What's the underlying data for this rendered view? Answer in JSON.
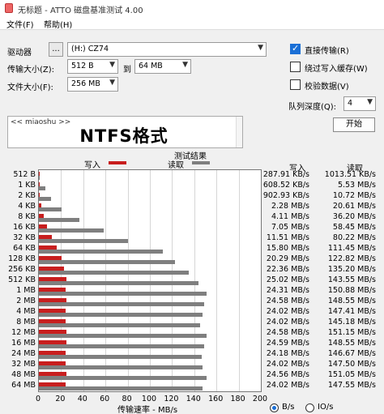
{
  "window": {
    "title": "无标题 - ATTO 磁盘基准测试 4.00"
  },
  "menu": {
    "file": "文件(F)",
    "help": "帮助(H)"
  },
  "drive": {
    "label": "驱动器",
    "browse": "...",
    "value": "(H:) CZ74"
  },
  "transfer": {
    "label": "传输大小(Z):",
    "from": "512 B",
    "to_label": "到",
    "to": "64 MB"
  },
  "filesize": {
    "label": "文件大小(F):",
    "value": "256 MB"
  },
  "options": {
    "direct_io": {
      "label": "直接传输(R)",
      "checked": true
    },
    "bypass_cache": {
      "label": "绕过写入缓存(W)",
      "checked": false
    },
    "verify": {
      "label": "校验数据(V)",
      "checked": false
    },
    "queue_label": "队列深度(Q):",
    "queue_value": "4"
  },
  "start_button": "开始",
  "description": {
    "top": "<< miaoshu >>",
    "main": "NTFS格式"
  },
  "results": {
    "title": "测试结果",
    "legend_write": "写入",
    "legend_read": "读取",
    "col_write": "写入",
    "col_read": "读取"
  },
  "axis": {
    "title": "传输速率 - MB/s",
    "ticks": [
      "0",
      "20",
      "40",
      "60",
      "80",
      "100",
      "120",
      "140",
      "160",
      "180",
      "200"
    ]
  },
  "units": {
    "bs": "B/s",
    "io": "IO/s"
  },
  "chart_data": {
    "type": "bar",
    "xlabel": "传输速率 - MB/s",
    "xlim": [
      0,
      200
    ],
    "categories": [
      "512 B",
      "1 KB",
      "2 KB",
      "4 KB",
      "8 KB",
      "16 KB",
      "32 KB",
      "64 KB",
      "128 KB",
      "256 KB",
      "512 KB",
      "1 MB",
      "2 MB",
      "4 MB",
      "8 MB",
      "12 MB",
      "16 MB",
      "24 MB",
      "32 MB",
      "48 MB",
      "64 MB"
    ],
    "series": [
      {
        "name": "写入",
        "color": "#c81e1e",
        "values": [
          0.288,
          0.609,
          0.903,
          2.28,
          4.11,
          7.05,
          11.51,
          15.8,
          20.29,
          22.36,
          25.02,
          24.31,
          24.58,
          24.02,
          24.02,
          24.58,
          24.59,
          24.18,
          24.02,
          24.56,
          24.02
        ],
        "labels": [
          "287.91 KB/s",
          "608.52 KB/s",
          "902.93 KB/s",
          "2.28 MB/s",
          "4.11 MB/s",
          "7.05 MB/s",
          "11.51 MB/s",
          "15.80 MB/s",
          "20.29 MB/s",
          "22.36 MB/s",
          "25.02 MB/s",
          "24.31 MB/s",
          "24.58 MB/s",
          "24.02 MB/s",
          "24.02 MB/s",
          "24.58 MB/s",
          "24.59 MB/s",
          "24.18 MB/s",
          "24.02 MB/s",
          "24.56 MB/s",
          "24.02 MB/s"
        ]
      },
      {
        "name": "读取",
        "color": "#7f7f7f",
        "values": [
          1.014,
          5.53,
          10.72,
          20.61,
          36.2,
          58.45,
          80.22,
          111.45,
          122.82,
          135.2,
          143.55,
          150.88,
          148.55,
          147.41,
          145.18,
          151.15,
          148.55,
          146.67,
          147.5,
          151.05,
          147.55
        ],
        "labels": [
          "1013.51 KB/s",
          "5.53 MB/s",
          "10.72 MB/s",
          "20.61 MB/s",
          "36.20 MB/s",
          "58.45 MB/s",
          "80.22 MB/s",
          "111.45 MB/s",
          "122.82 MB/s",
          "135.20 MB/s",
          "143.55 MB/s",
          "150.88 MB/s",
          "148.55 MB/s",
          "147.41 MB/s",
          "145.18 MB/s",
          "151.15 MB/s",
          "148.55 MB/s",
          "146.67 MB/s",
          "147.50 MB/s",
          "151.05 MB/s",
          "147.55 MB/s"
        ]
      }
    ]
  }
}
